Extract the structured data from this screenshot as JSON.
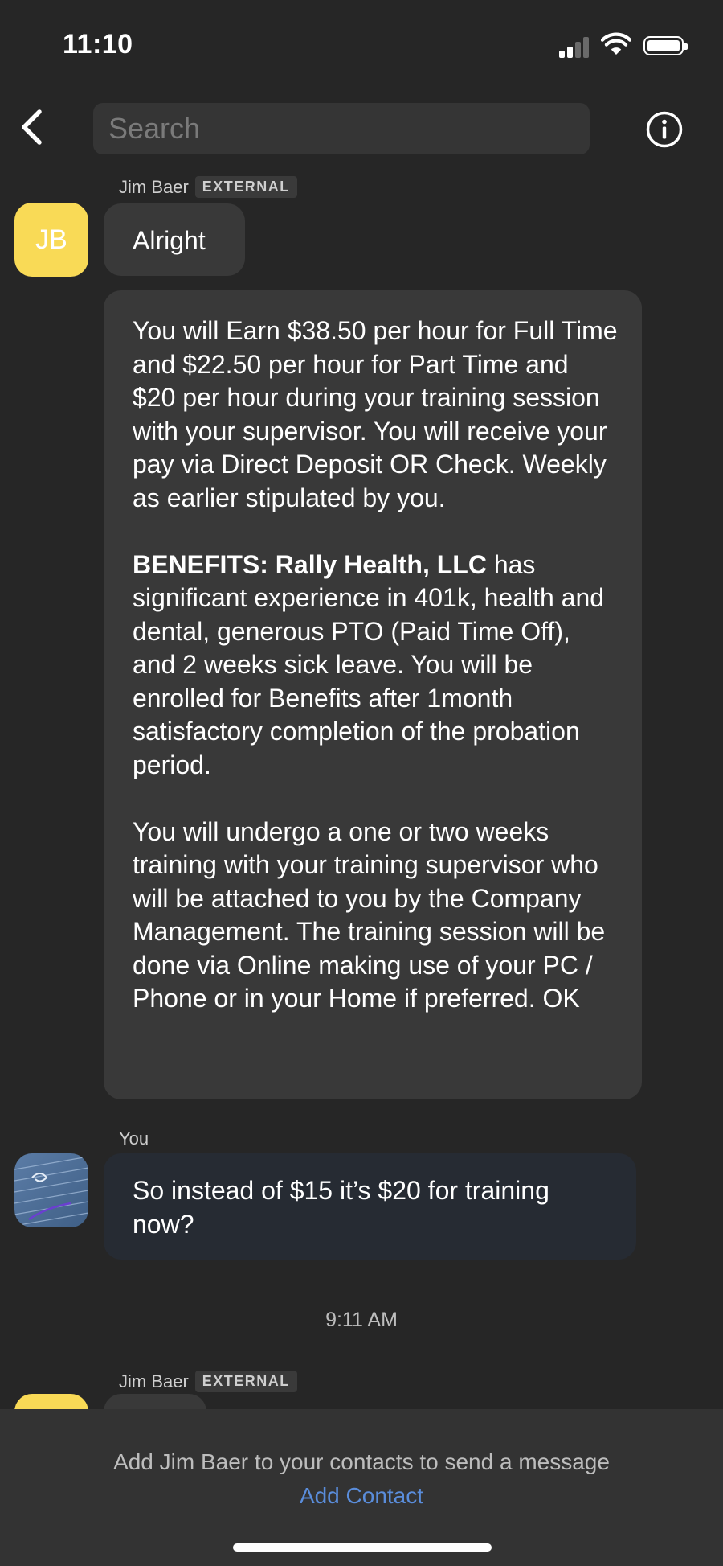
{
  "status_bar": {
    "time": "11:10"
  },
  "nav": {
    "search_placeholder": "Search"
  },
  "messages": [
    {
      "sender": "Jim Baer",
      "badge": "EXTERNAL",
      "avatar_initials": "JB",
      "text": "Alright"
    },
    {
      "paragraphs": [
        "You will Earn $38.50 per hour for Full Time and $22.50 per hour for Part Time and $20 per hour during your training session with your supervisor. You will receive your pay via Direct Deposit OR Check. Weekly as earlier stipulated by you.",
        {
          "bold": "BENEFITS: Rally Health, LLC",
          "rest": " has significant experience in 401k, health and dental, generous PTO (Paid Time Off), and 2 weeks sick leave. You will be enrolled for Benefits after 1month satisfactory completion of the probation period."
        },
        "You will undergo a one or two weeks training with your training supervisor who will be attached to you by the Company Management. The training session will be done via Online making use of your PC / Phone or in your Home if preferred. OK"
      ]
    },
    {
      "sender": "You",
      "text": "So instead of $15 it’s $20 for training now?"
    }
  ],
  "timestamp": "9:11 AM",
  "next_message": {
    "sender": "Jim Baer",
    "badge": "EXTERNAL"
  },
  "footer": {
    "notice": "Add Jim Baer to your contacts to send a message",
    "add_contact_label": "Add Contact"
  },
  "colors": {
    "avatar_jb": "#f9da56",
    "link": "#5a8ddb",
    "bubble": "#393939",
    "bubble_you": "#262b33"
  }
}
